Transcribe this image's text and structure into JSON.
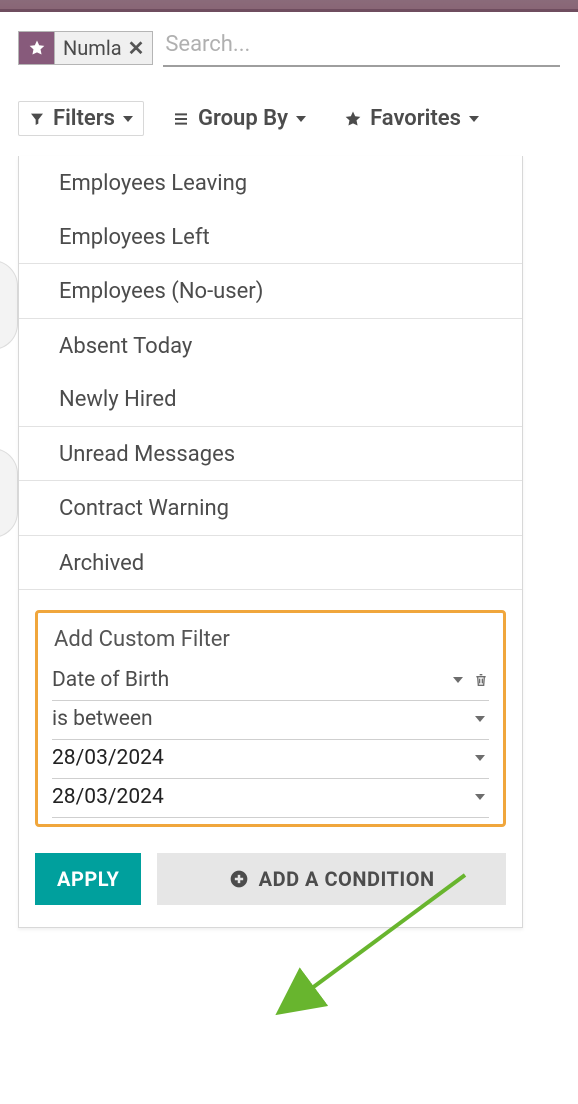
{
  "search": {
    "chip_label": "Numla",
    "placeholder": "Search..."
  },
  "controls": {
    "filters": "Filters",
    "group_by": "Group By",
    "favorites": "Favorites"
  },
  "filter_groups": [
    [
      "Employees Leaving",
      "Employees Left"
    ],
    [
      "Employees (No-user)"
    ],
    [
      "Absent Today",
      "Newly Hired"
    ],
    [
      "Unread Messages"
    ],
    [
      "Contract Warning"
    ],
    [
      "Archived"
    ]
  ],
  "custom_filter": {
    "title": "Add Custom Filter",
    "field": "Date of Birth",
    "operator": "is between",
    "date_from": "28/03/2024",
    "date_to": "28/03/2024"
  },
  "buttons": {
    "apply": "APPLY",
    "add_condition": "ADD A CONDITION"
  }
}
